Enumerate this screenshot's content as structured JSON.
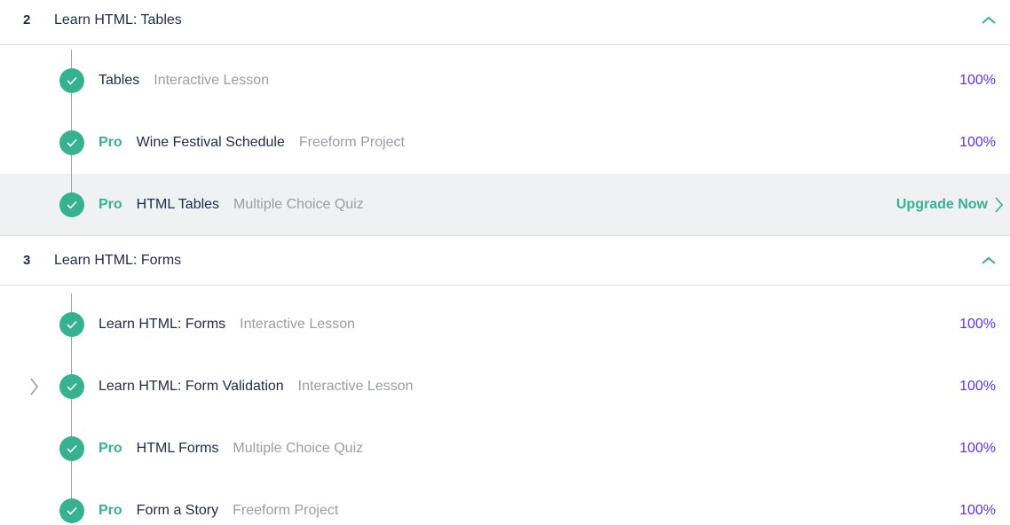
{
  "colors": {
    "accent_green": "#36b290",
    "percent_purple": "#5533ff",
    "muted_text": "#9a9da3",
    "title_text": "#1b2b4a",
    "highlight_bg": "#eff1f2"
  },
  "sections": [
    {
      "number": "2",
      "title": "Learn HTML: Tables",
      "collapse_icon": "chevron-up-icon",
      "items": [
        {
          "pro": "",
          "title": "Tables",
          "type": "Interactive Lesson",
          "status": "100%"
        },
        {
          "pro": "Pro",
          "title": "Wine Festival Schedule",
          "type": "Freeform Project",
          "status": "100%"
        },
        {
          "pro": "Pro",
          "title": "HTML Tables",
          "type": "Multiple Choice Quiz",
          "upgrade_label": "Upgrade Now"
        }
      ]
    },
    {
      "number": "3",
      "title": "Learn HTML: Forms",
      "collapse_icon": "chevron-up-icon",
      "items": [
        {
          "pro": "",
          "title": "Learn HTML: Forms",
          "type": "Interactive Lesson",
          "status": "100%"
        },
        {
          "pro": "",
          "title": "Learn HTML: Form Validation",
          "type": "Interactive Lesson",
          "status": "100%"
        },
        {
          "pro": "Pro",
          "title": "HTML Forms",
          "type": "Multiple Choice Quiz",
          "status": "100%"
        },
        {
          "pro": "Pro",
          "title": "Form a Story",
          "type": "Freeform Project",
          "status": "100%"
        }
      ]
    }
  ]
}
